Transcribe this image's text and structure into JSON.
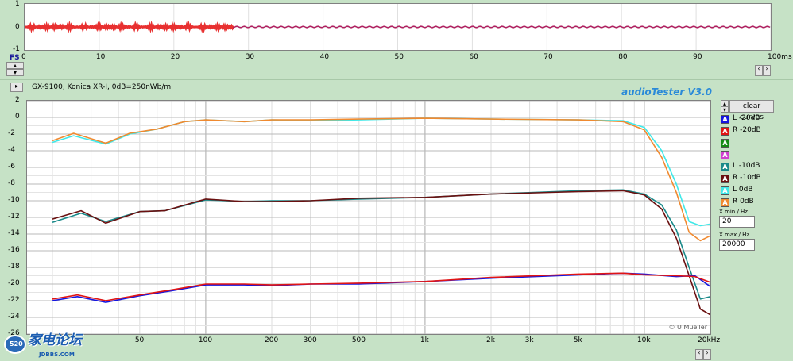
{
  "time_panel": {
    "y_ticks": [
      "1",
      "0",
      "-1"
    ],
    "fs_label": "FS",
    "x_ticks": [
      "0",
      "10",
      "20",
      "30",
      "40",
      "50",
      "60",
      "70",
      "80",
      "90",
      "100ms"
    ]
  },
  "header": {
    "description": "GX-9100, Konica XR-I, 0dB=250nWb/m",
    "app_title": "audioTester  V3.0"
  },
  "freq_panel": {
    "y_ticks": [
      "2",
      "0",
      "-2",
      "-4",
      "-6",
      "-8",
      "-10",
      "-12",
      "-14",
      "-16",
      "-18",
      "-20",
      "-22",
      "-24",
      "-26"
    ],
    "x_ticks": [
      "50",
      "100",
      "200",
      "300",
      "500",
      "1k",
      "2k",
      "3k",
      "5k",
      "10k",
      "20kHz"
    ],
    "credit": "© U Mueller"
  },
  "side": {
    "clear_button": "clear curves",
    "curves": [
      {
        "tag": "A",
        "label": "L  -20dB",
        "color": "#1515e0"
      },
      {
        "tag": "A",
        "label": "R -20dB",
        "color": "#e01515"
      },
      {
        "tag": "A",
        "label": "",
        "color": "#158a15"
      },
      {
        "tag": "A",
        "label": "",
        "color": "#d040d0"
      },
      {
        "tag": "A",
        "label": "L  -10dB",
        "color": "#1a8a8a"
      },
      {
        "tag": "A",
        "label": "R  -10dB",
        "color": "#6a1010"
      },
      {
        "tag": "A",
        "label": "L  0dB",
        "color": "#40e8e8"
      },
      {
        "tag": "A",
        "label": "R  0dB",
        "color": "#f08a30"
      }
    ],
    "xmin_label": "X min / Hz",
    "xmin_value": "20",
    "xmax_label": "X max / Hz",
    "xmax_value": "20000"
  },
  "watermark": {
    "logo_text": "家电论坛",
    "sub_text": "JDBBS.COM",
    "badge": "520"
  },
  "chart_data": {
    "type": "line",
    "x_scale": "log",
    "xlim": [
      20,
      20000
    ],
    "ylim": [
      -26,
      2
    ],
    "ylabel_unit": "dB",
    "grid": true,
    "series": [
      {
        "name": "L  0dB",
        "color": "#40e8e8",
        "points": [
          [
            20,
            -3.0
          ],
          [
            25,
            -2.2
          ],
          [
            35,
            -3.2
          ],
          [
            45,
            -2.0
          ],
          [
            60,
            -1.4
          ],
          [
            80,
            -0.5
          ],
          [
            100,
            -0.3
          ],
          [
            150,
            -0.5
          ],
          [
            200,
            -0.3
          ],
          [
            300,
            -0.4
          ],
          [
            500,
            -0.3
          ],
          [
            1000,
            -0.1
          ],
          [
            2000,
            -0.2
          ],
          [
            5000,
            -0.3
          ],
          [
            8000,
            -0.4
          ],
          [
            10000,
            -1.2
          ],
          [
            12000,
            -4.0
          ],
          [
            14000,
            -8.0
          ],
          [
            16000,
            -12.5
          ],
          [
            18000,
            -13.0
          ],
          [
            20000,
            -12.8
          ]
        ]
      },
      {
        "name": "R  0dB",
        "color": "#f08a30",
        "points": [
          [
            20,
            -2.8
          ],
          [
            25,
            -1.9
          ],
          [
            35,
            -3.1
          ],
          [
            45,
            -1.9
          ],
          [
            60,
            -1.4
          ],
          [
            80,
            -0.5
          ],
          [
            100,
            -0.3
          ],
          [
            150,
            -0.5
          ],
          [
            200,
            -0.3
          ],
          [
            300,
            -0.3
          ],
          [
            500,
            -0.2
          ],
          [
            1000,
            -0.1
          ],
          [
            2000,
            -0.2
          ],
          [
            5000,
            -0.3
          ],
          [
            8000,
            -0.5
          ],
          [
            10000,
            -1.5
          ],
          [
            12000,
            -4.8
          ],
          [
            14000,
            -9.0
          ],
          [
            16000,
            -13.8
          ],
          [
            18000,
            -14.8
          ],
          [
            20000,
            -14.2
          ]
        ]
      },
      {
        "name": "L  -10dB",
        "color": "#1a8a8a",
        "points": [
          [
            20,
            -12.6
          ],
          [
            27,
            -11.5
          ],
          [
            35,
            -12.5
          ],
          [
            50,
            -11.3
          ],
          [
            65,
            -11.2
          ],
          [
            100,
            -9.9
          ],
          [
            150,
            -10.1
          ],
          [
            200,
            -10.0
          ],
          [
            300,
            -10.0
          ],
          [
            500,
            -9.8
          ],
          [
            1000,
            -9.6
          ],
          [
            2000,
            -9.2
          ],
          [
            5000,
            -8.8
          ],
          [
            8000,
            -8.7
          ],
          [
            10000,
            -9.2
          ],
          [
            12000,
            -10.5
          ],
          [
            14000,
            -13.5
          ],
          [
            16000,
            -18.0
          ],
          [
            18000,
            -21.8
          ],
          [
            20000,
            -21.5
          ]
        ]
      },
      {
        "name": "R  -10dB",
        "color": "#6a1010",
        "points": [
          [
            20,
            -12.2
          ],
          [
            27,
            -11.2
          ],
          [
            35,
            -12.7
          ],
          [
            50,
            -11.3
          ],
          [
            65,
            -11.2
          ],
          [
            100,
            -9.8
          ],
          [
            150,
            -10.1
          ],
          [
            200,
            -10.1
          ],
          [
            300,
            -10.0
          ],
          [
            500,
            -9.7
          ],
          [
            1000,
            -9.6
          ],
          [
            2000,
            -9.2
          ],
          [
            5000,
            -8.9
          ],
          [
            8000,
            -8.8
          ],
          [
            10000,
            -9.3
          ],
          [
            12000,
            -11.0
          ],
          [
            14000,
            -14.5
          ],
          [
            16000,
            -19.0
          ],
          [
            18000,
            -23.0
          ],
          [
            20000,
            -23.7
          ]
        ]
      },
      {
        "name": "L  -20dB",
        "color": "#1515e0",
        "points": [
          [
            20,
            -22.0
          ],
          [
            26,
            -21.5
          ],
          [
            35,
            -22.2
          ],
          [
            50,
            -21.4
          ],
          [
            70,
            -20.8
          ],
          [
            100,
            -20.1
          ],
          [
            150,
            -20.1
          ],
          [
            200,
            -20.2
          ],
          [
            300,
            -20.0
          ],
          [
            500,
            -20.0
          ],
          [
            1000,
            -19.7
          ],
          [
            2000,
            -19.3
          ],
          [
            5000,
            -18.9
          ],
          [
            8000,
            -18.7
          ],
          [
            10000,
            -18.8
          ],
          [
            14000,
            -19.1
          ],
          [
            17000,
            -19.0
          ],
          [
            20000,
            -20.3
          ]
        ]
      },
      {
        "name": "R -20dB",
        "color": "#e01515",
        "points": [
          [
            20,
            -21.8
          ],
          [
            26,
            -21.3
          ],
          [
            35,
            -22.0
          ],
          [
            50,
            -21.3
          ],
          [
            70,
            -20.7
          ],
          [
            100,
            -20.0
          ],
          [
            150,
            -20.0
          ],
          [
            200,
            -20.1
          ],
          [
            300,
            -20.0
          ],
          [
            500,
            -19.9
          ],
          [
            1000,
            -19.7
          ],
          [
            2000,
            -19.2
          ],
          [
            5000,
            -18.8
          ],
          [
            8000,
            -18.7
          ],
          [
            10000,
            -18.9
          ],
          [
            14000,
            -19.0
          ],
          [
            17000,
            -19.1
          ],
          [
            20000,
            -19.8
          ]
        ]
      }
    ],
    "time_domain": {
      "xlim": [
        0,
        100
      ],
      "ylim": [
        -1,
        1
      ],
      "xunit": "ms",
      "burst_end_ms": 28
    }
  }
}
